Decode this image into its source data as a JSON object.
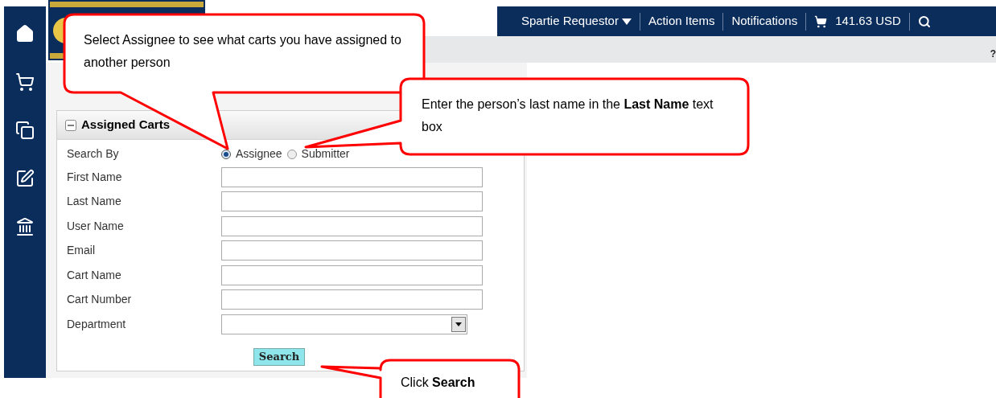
{
  "top_bar": {
    "items": [
      {
        "kind": "menu",
        "label": "Spartie Requestor"
      },
      {
        "kind": "link",
        "label": "Action Items"
      },
      {
        "kind": "link",
        "label": "Notifications"
      },
      {
        "kind": "cart",
        "label": "141.63 USD"
      }
    ],
    "help": "?"
  },
  "panel": {
    "title": "Assigned Carts",
    "search_by": {
      "label": "Search By",
      "options": [
        {
          "label": "Assignee",
          "selected": true
        },
        {
          "label": "Submitter",
          "selected": false
        }
      ]
    },
    "fields": [
      {
        "kind": "text",
        "label": "First Name"
      },
      {
        "kind": "text",
        "label": "Last Name"
      },
      {
        "kind": "text",
        "label": "User Name"
      },
      {
        "kind": "text",
        "label": "Email"
      },
      {
        "kind": "text",
        "label": "Cart Name"
      },
      {
        "kind": "text",
        "label": "Cart Number"
      },
      {
        "kind": "select",
        "label": "Department"
      }
    ],
    "button": "Search"
  },
  "callouts": [
    {
      "text": "Select Assignee to see what carts you have assigned to another person"
    },
    {
      "text": "Enter the person’s last name in the **Last Name** text box"
    },
    {
      "text": "Click **Search**"
    }
  ]
}
